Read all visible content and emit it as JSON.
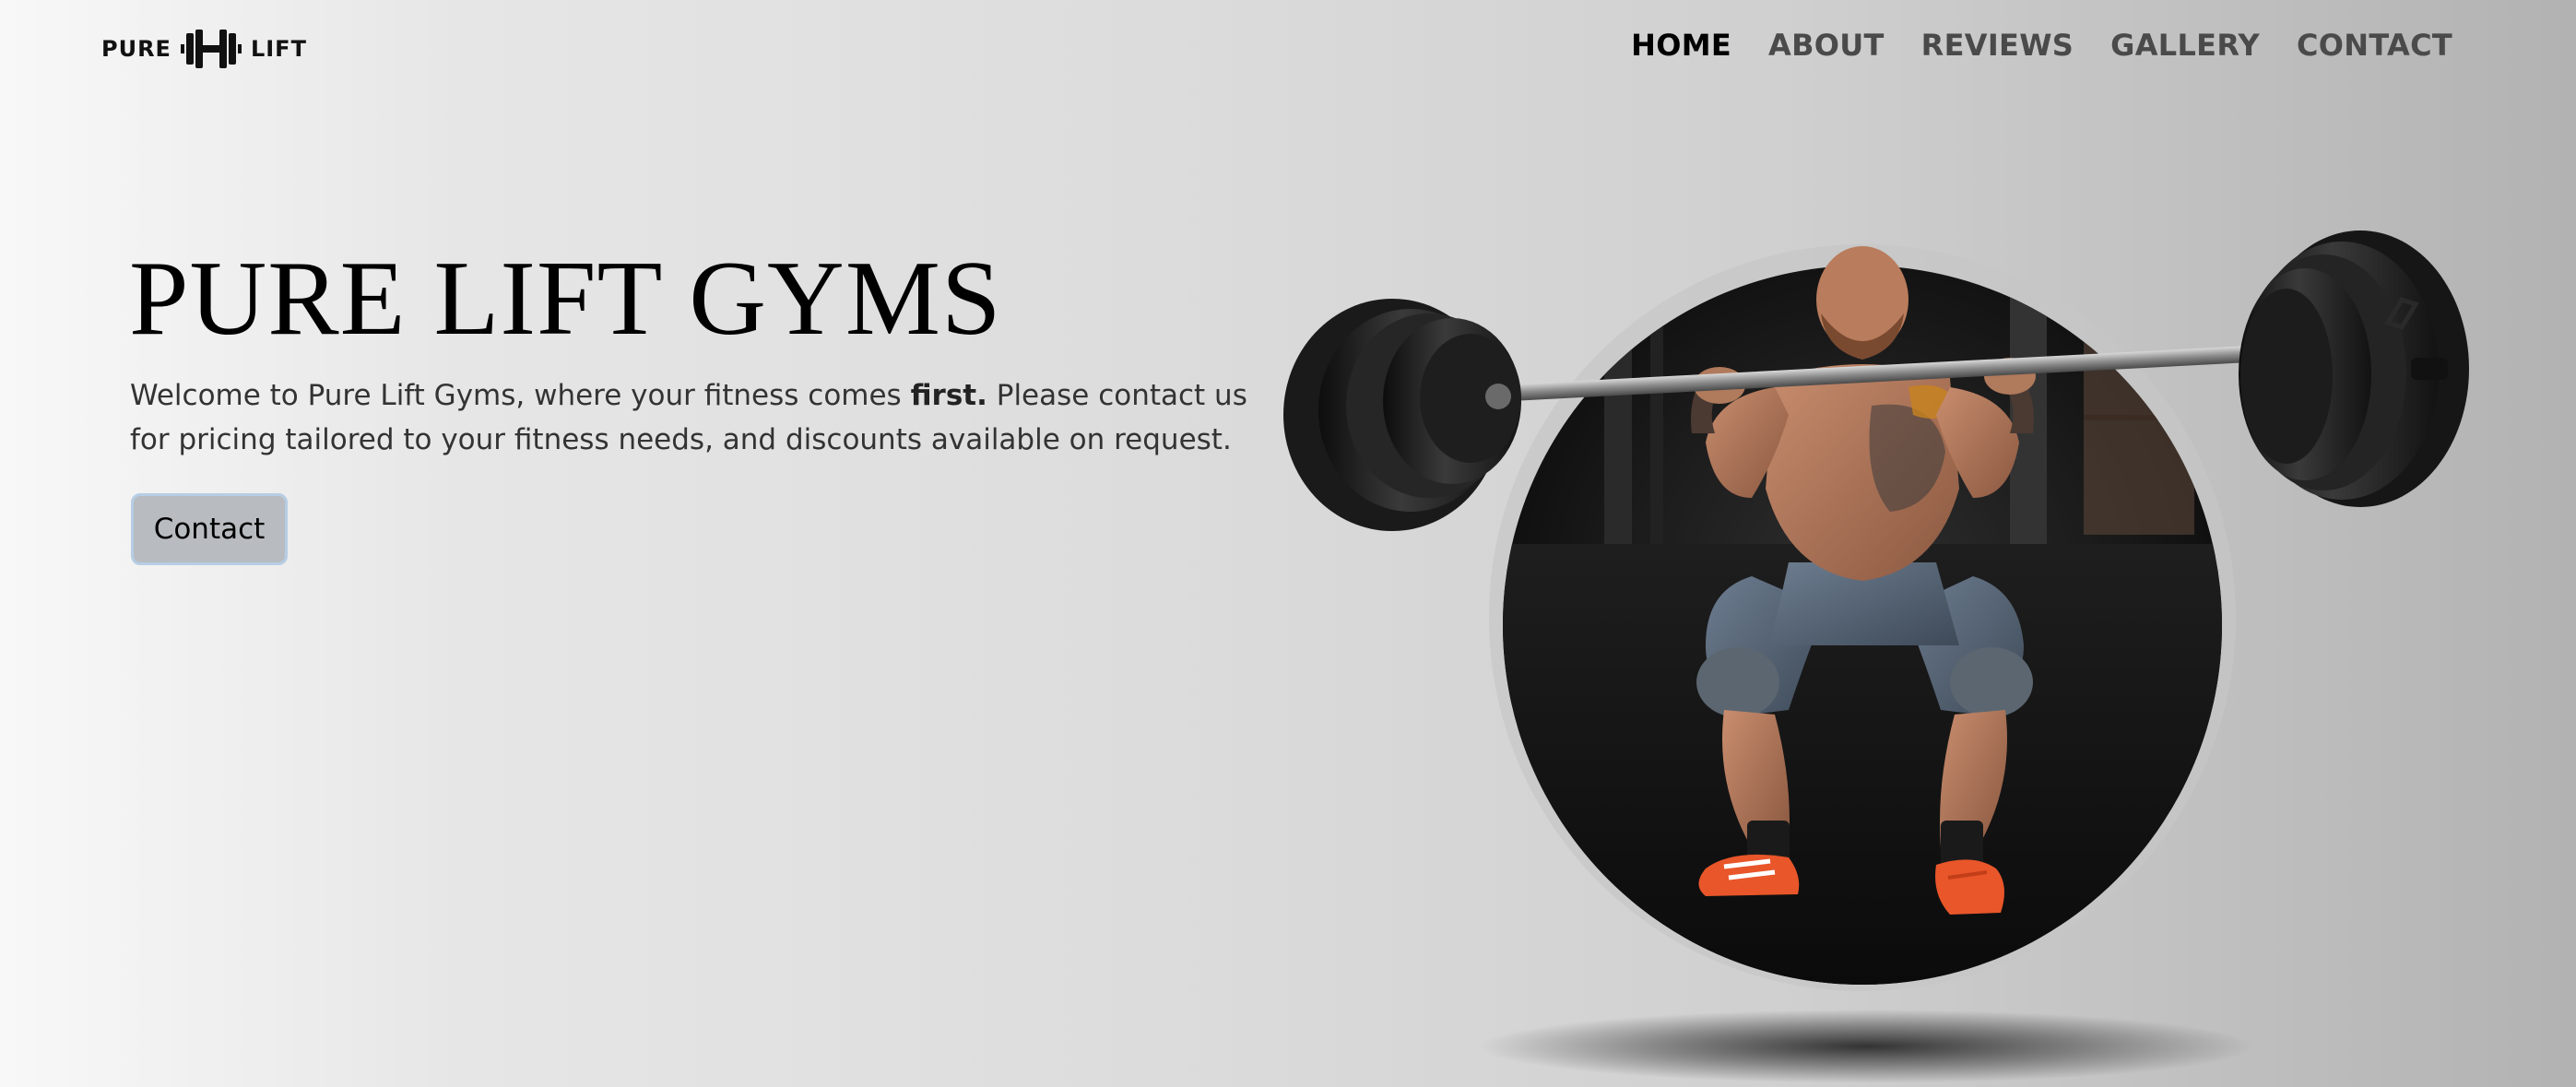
{
  "brand": {
    "left": "PURE",
    "right": "LIFT"
  },
  "nav": {
    "items": [
      {
        "label": "HOME",
        "active": true
      },
      {
        "label": "ABOUT",
        "active": false
      },
      {
        "label": "REVIEWS",
        "active": false
      },
      {
        "label": "GALLERY",
        "active": false
      },
      {
        "label": "CONTACT",
        "active": false
      }
    ]
  },
  "hero": {
    "title": "PURE LIFT GYMS",
    "text_before": "Welcome to Pure Lift Gyms, where your fitness comes ",
    "text_bold": "first.",
    "text_after": " Please contact us for pricing tailored to your fitness needs, and discounts available on request.",
    "button_label": "Contact",
    "image_subject": "man-squatting-barbell-photo"
  },
  "colors": {
    "accent_border": "#b6cde4",
    "button_bg": "#b8bcc0",
    "shoe_accent": "#e8562a"
  },
  "icons": {
    "logo": "dumbbell-h-logo"
  }
}
